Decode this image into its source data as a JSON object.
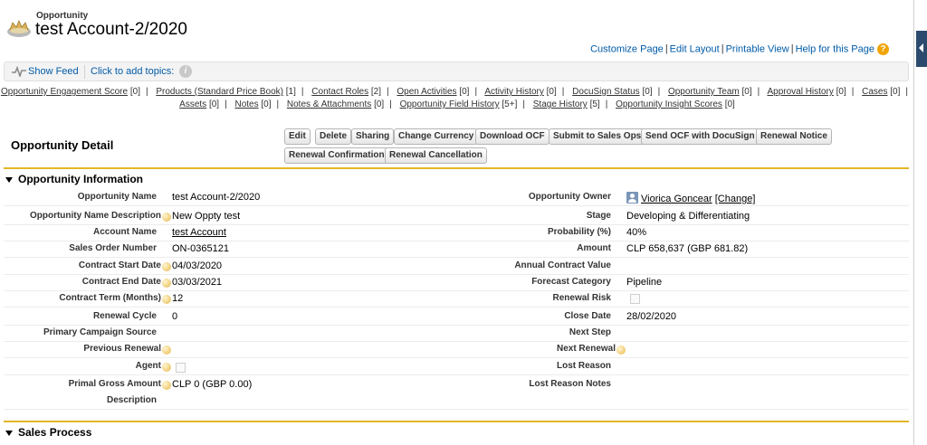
{
  "header": {
    "object_type": "Opportunity",
    "record_title": "test Account-2/2020",
    "links": [
      "Customize Page",
      "Edit Layout",
      "Printable View",
      "Help for this Page"
    ],
    "help_icon": "?"
  },
  "feed": {
    "show_feed": "Show Feed",
    "topics": "Click to add topics:",
    "info_icon": "i"
  },
  "related_links": {
    "row1": [
      {
        "label": "Opportunity Engagement Score",
        "count": "[0]"
      },
      {
        "label": "Products (Standard Price Book)",
        "count": "[1]"
      },
      {
        "label": "Contact Roles",
        "count": "[2]"
      },
      {
        "label": "Open Activities",
        "count": "[0]"
      },
      {
        "label": "Activity History",
        "count": "[0]"
      },
      {
        "label": "DocuSign Status",
        "count": "[0]"
      },
      {
        "label": "Opportunity Team",
        "count": "[0]"
      },
      {
        "label": "Approval History",
        "count": "[0]"
      },
      {
        "label": "Cases",
        "count": "[0]"
      }
    ],
    "row2": [
      {
        "label": "Assets",
        "count": "[0]"
      },
      {
        "label": "Notes",
        "count": "[0]"
      },
      {
        "label": "Notes & Attachments",
        "count": "[0]"
      },
      {
        "label": "Opportunity Field History",
        "count": "[5+]"
      },
      {
        "label": "Stage History",
        "count": "[5]"
      },
      {
        "label": "Opportunity Insight Scores",
        "count": "[0]"
      }
    ]
  },
  "detail": {
    "title": "Opportunity Detail",
    "buttons": {
      "edit": "Edit",
      "delete": "Delete",
      "sharing": "Sharing",
      "change_currency": "Change Currency",
      "download_ocf": "Download OCF",
      "submit_sales_ops": "Submit to Sales Ops",
      "send_ocf_docusign": "Send OCF with DocuSign",
      "renewal_notice": "Renewal Notice",
      "renewal_confirmation": "Renewal Confirmation",
      "renewal_cancellation": "Renewal Cancellation"
    }
  },
  "sections": {
    "info": "Opportunity Information",
    "sales": "Sales Process"
  },
  "fields": {
    "opp_name": {
      "label": "Opportunity Name",
      "value": "test Account-2/2020"
    },
    "opp_owner": {
      "label": "Opportunity Owner",
      "value": "Viorica Goncear",
      "change": "[Change]"
    },
    "opp_name_desc": {
      "label": "Opportunity Name Description",
      "value": "New Oppty test"
    },
    "stage": {
      "label": "Stage",
      "value": "Developing & Differentiating"
    },
    "account_name": {
      "label": "Account Name",
      "value": "test Account"
    },
    "probability": {
      "label": "Probability (%)",
      "value": "40%"
    },
    "sales_order": {
      "label": "Sales Order Number",
      "value": "ON-0365121"
    },
    "amount": {
      "label": "Amount",
      "value": "CLP 658,637 (GBP 681.82)"
    },
    "contract_start": {
      "label": "Contract Start Date",
      "value": "04/03/2020"
    },
    "annual_value": {
      "label": "Annual Contract Value",
      "value": ""
    },
    "contract_end": {
      "label": "Contract End Date",
      "value": "03/03/2021"
    },
    "forecast": {
      "label": "Forecast Category",
      "value": "Pipeline"
    },
    "contract_term": {
      "label": "Contract Term (Months)",
      "value": "12"
    },
    "renewal_risk": {
      "label": "Renewal Risk",
      "value": ""
    },
    "renewal_cycle": {
      "label": "Renewal Cycle",
      "value": "0"
    },
    "close_date": {
      "label": "Close Date",
      "value": "28/02/2020"
    },
    "primary_campaign": {
      "label": "Primary Campaign Source",
      "value": ""
    },
    "next_step": {
      "label": "Next Step",
      "value": ""
    },
    "previous_renewal": {
      "label": "Previous Renewal",
      "value": ""
    },
    "next_renewal": {
      "label": "Next Renewal",
      "value": ""
    },
    "agent": {
      "label": "Agent",
      "value": ""
    },
    "lost_reason": {
      "label": "Lost Reason",
      "value": ""
    },
    "primal_gross": {
      "label": "Primal Gross Amount",
      "value": "CLP 0 (GBP 0.00)"
    },
    "lost_reason_notes": {
      "label": "Lost Reason Notes",
      "value": ""
    },
    "description": {
      "label": "Description",
      "value": ""
    }
  }
}
